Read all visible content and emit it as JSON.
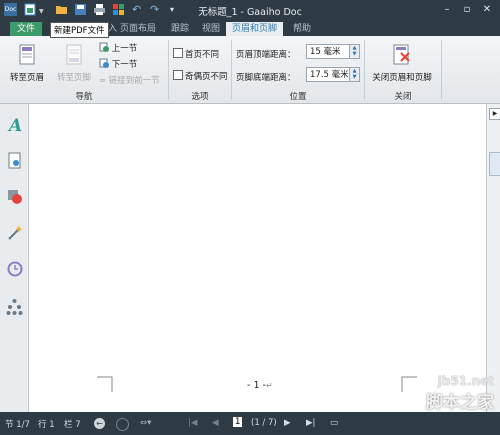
{
  "titlebar": {
    "app_logo": "Doc",
    "title": "无标题_1 - Gaaiho Doc",
    "quick_access_icons": [
      "new-pdf-icon",
      "open-folder-icon",
      "save-icon",
      "print-icon",
      "tools-icon",
      "undo-icon",
      "redo-icon",
      "customize-icon"
    ]
  },
  "tabs": {
    "file": "文件",
    "items": [
      "页面布局",
      "跟踪",
      "视图",
      "页眉和页脚",
      "帮助"
    ],
    "active": "页眉和页脚",
    "partial_hidden": "入"
  },
  "tooltip": "新建PDF文件",
  "ribbon": {
    "nav": {
      "goto_header": "转至页眉",
      "goto_footer": "转至页脚",
      "prev_section": "上一节",
      "next_section": "下一节",
      "link_prev": "链接到前一节",
      "group_label": "导航"
    },
    "options": {
      "diff_first_page": "首页不同",
      "diff_odd_even": "奇偶页不同",
      "group_label": "选项"
    },
    "position": {
      "header_distance_label": "页眉顶端距离：",
      "header_distance_value": "15 毫米",
      "footer_distance_label": "页脚底端距离：",
      "footer_distance_value": "17.5 毫米",
      "group_label": "位置"
    },
    "close": {
      "close_button": "关闭页眉和页脚",
      "group_label": "关闭"
    }
  },
  "sidebar": {
    "icons": [
      "text-style-icon",
      "page-icon",
      "shapes-icon",
      "magic-wand-icon",
      "history-icon",
      "hierarchy-icon"
    ]
  },
  "document": {
    "page_number": "- 1 -",
    "paragraph_mark": "↵"
  },
  "statusbar": {
    "section": "节 1/7",
    "line": "行 1",
    "column": "栏 7",
    "page_current": "1",
    "page_total": "(1 / 7)"
  },
  "watermark": {
    "url": "jb51.net",
    "site": "脚本之家"
  },
  "colors": {
    "titlebar": "#2f3b44",
    "file_tab": "#3d9a6a",
    "active_tab_text": "#2c7fb6",
    "ribbon": "#eef1f3"
  }
}
